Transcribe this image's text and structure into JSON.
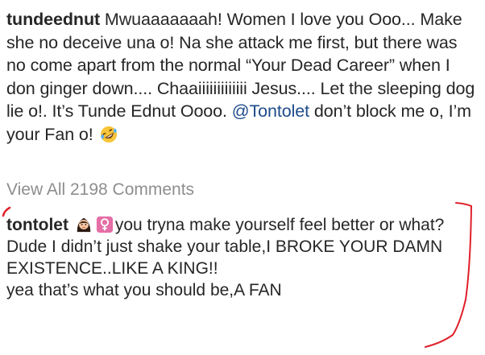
{
  "post": {
    "caption": {
      "username": "tundeednut",
      "text_before_mention": " Mwuaaaaaaah! Women I love you Ooo... Make she no deceive una o! Na she attack me first, but there was no come apart from the normal “Your Dead Career” when I don ginger down.... Chaaiiiiiiiiiiiii Jesus.... Let the sleeping dog lie o!. It’s Tunde Ednut Oooo. ",
      "mention": "@Tontolet",
      "text_after_mention": " don’t block me o, I’m your Fan o! ",
      "trailing_icon": "rofl-emoji-icon"
    },
    "view_all_comments": "View All 2198 Comments"
  },
  "comment": {
    "username": "tontolet",
    "icons": [
      "woman-emoji-icon",
      "female-sign-emoji-icon"
    ],
    "line1": "you tryna make yourself feel better or what?",
    "line2": "Dude I didn’t just shake your table,I BROKE YOUR DAMN EXISTENCE..LIKE A KING!!",
    "line3": "yea that’s what you should be,A FAN"
  },
  "colors": {
    "text": "#262626",
    "mention": "#1e4b8a",
    "muted": "#8e8e8e",
    "annotation": "#e0202a"
  }
}
